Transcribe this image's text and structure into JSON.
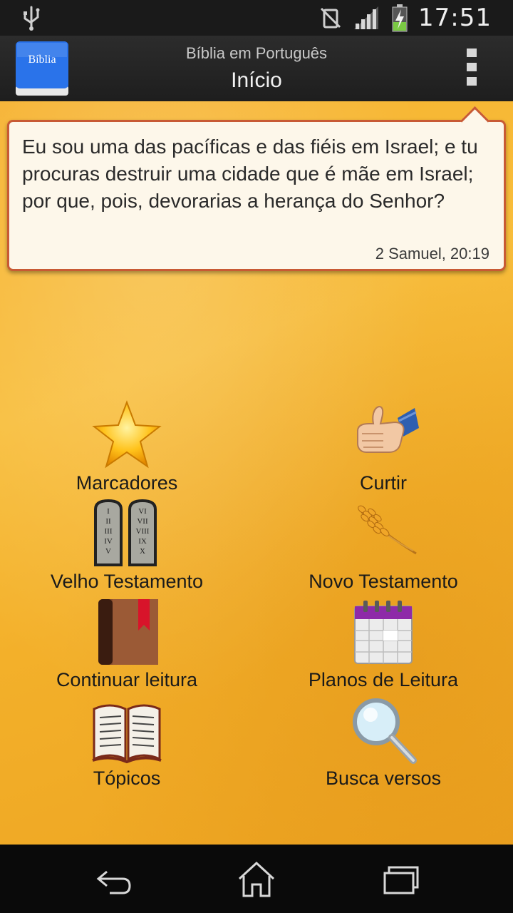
{
  "status_bar": {
    "time": "17:51"
  },
  "app_bar": {
    "icon_text": "Bíblia",
    "subtitle": "Bíblia em Português",
    "title": "Início"
  },
  "verse": {
    "text": "Eu sou uma das pacíficas e das fiéis em Israel; e tu procuras destruir uma cidade que é mãe em Israel; por que, pois, devorarias a herança do Senhor?",
    "reference": "2 Samuel, 20:19"
  },
  "menu": [
    {
      "label": "Marcadores",
      "icon": "star-icon"
    },
    {
      "label": "Curtir",
      "icon": "thumbs-up-icon"
    },
    {
      "label": "Velho Testamento",
      "icon": "stone-tablets-icon",
      "tablet_left": [
        "I",
        "II",
        "III",
        "IV",
        "V"
      ],
      "tablet_right": [
        "VI",
        "VII",
        "VIII",
        "IX",
        "X"
      ]
    },
    {
      "label": "Novo Testamento",
      "icon": "wheat-icon"
    },
    {
      "label": "Continuar leitura",
      "icon": "bookmark-book-icon"
    },
    {
      "label": "Planos de Leitura",
      "icon": "calendar-icon"
    },
    {
      "label": "Tópicos",
      "icon": "open-book-icon"
    },
    {
      "label": "Busca versos",
      "icon": "magnifier-icon"
    }
  ],
  "colors": {
    "background": "#f6b12d",
    "card_border": "#c85a34",
    "card_bg": "#fdf7ea"
  }
}
